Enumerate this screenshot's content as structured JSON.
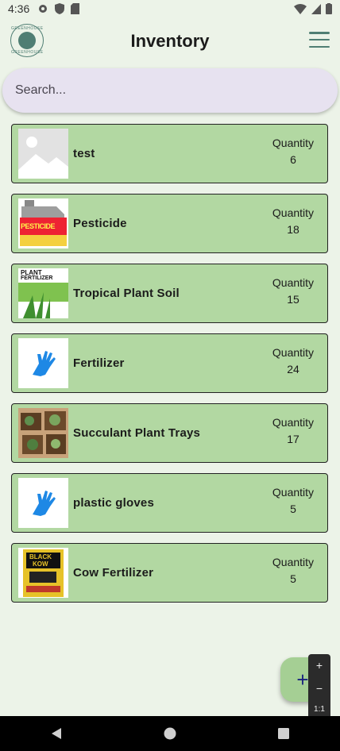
{
  "status": {
    "time": "4:36"
  },
  "app_bar": {
    "title": "Inventory",
    "logo_text_top": "GREENHOUSE",
    "logo_text_bottom": "GREENHOUSE"
  },
  "search": {
    "placeholder": "Search...",
    "value": ""
  },
  "items": [
    {
      "name": "test",
      "quantity_label": "Quantity",
      "quantity": "6",
      "image": "placeholder-image"
    },
    {
      "name": "Pesticide",
      "quantity_label": "Quantity",
      "quantity": "18",
      "image": "pesticide-can"
    },
    {
      "name": "Tropical Plant Soil",
      "quantity_label": "Quantity",
      "quantity": "15",
      "image": "plant-fertilizer-bag"
    },
    {
      "name": "Fertilizer",
      "quantity_label": "Quantity",
      "quantity": "24",
      "image": "blue-glove"
    },
    {
      "name": "Succulant Plant Trays",
      "quantity_label": "Quantity",
      "quantity": "17",
      "image": "succulent-trays"
    },
    {
      "name": "plastic gloves",
      "quantity_label": "Quantity",
      "quantity": "5",
      "image": "blue-glove"
    },
    {
      "name": "Cow Fertilizer",
      "quantity_label": "Quantity",
      "quantity": "5",
      "image": "black-kow-bag"
    }
  ],
  "fab": {
    "label": "+"
  },
  "zoom": {
    "plus": "+",
    "minus": "−",
    "ratio": "1:1"
  },
  "images": {
    "pesticide_label": "PESTICIDE",
    "fertilizer_label_1": "PLANT",
    "fertilizer_label_2": "FERTILIZER",
    "black_kow_label_1": "BLACK",
    "black_kow_label_2": "KOW"
  },
  "colors": {
    "card": "#b2d8a2",
    "background": "#ecf3e8",
    "accent": "#4f7e73",
    "search": "#e7e2f0"
  }
}
